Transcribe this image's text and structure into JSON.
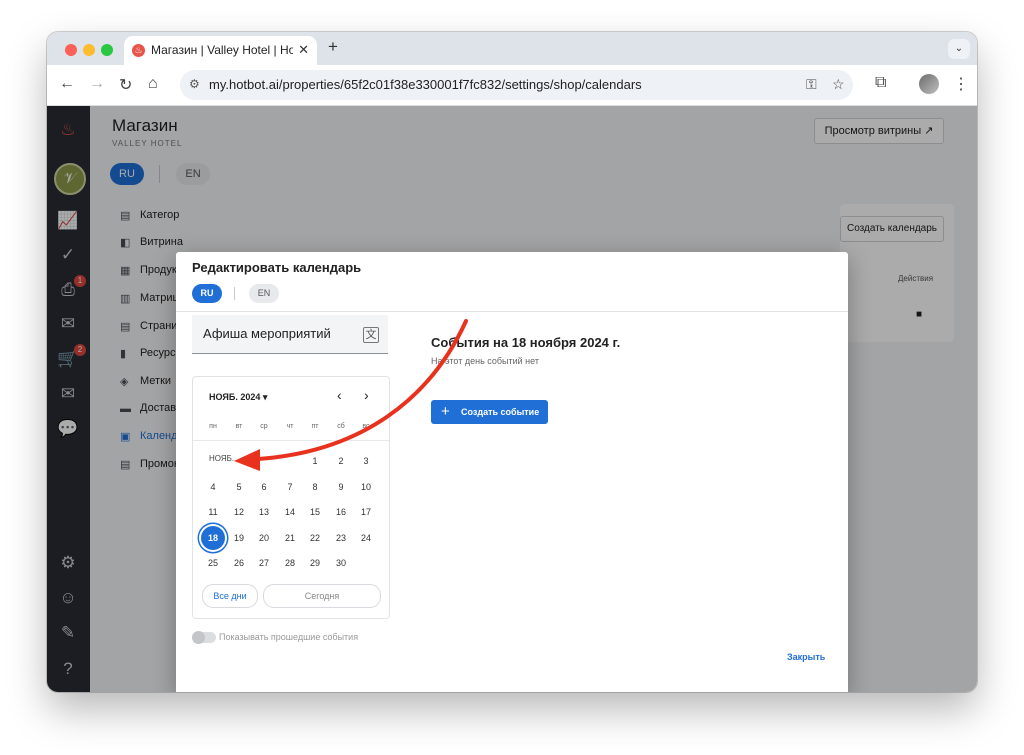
{
  "browser": {
    "tab_title": "Магазин | Valley Hotel | Hotbot",
    "tab_favicon": "flame-icon",
    "url": "my.hotbot.ai/properties/65f2c01f38e330001f7fc832/settings/shop/calendars"
  },
  "app": {
    "shop_title": "Магазин",
    "shop_subtitle": "VALLEY HOTEL",
    "storefront_button": "Просмотр витрины ↗",
    "lang_ru": "RU",
    "lang_en": "EN",
    "sidebar_badges": {
      "inbox": "1",
      "cart": "2"
    },
    "menu": [
      {
        "label": "Категор",
        "icon": "category-icon"
      },
      {
        "label": "Витрина",
        "icon": "storefront-icon"
      },
      {
        "label": "Продукт",
        "icon": "products-icon"
      },
      {
        "label": "Матрица",
        "icon": "matrix-icon"
      },
      {
        "label": "Страниц",
        "icon": "page-icon"
      },
      {
        "label": "Ресурсы",
        "icon": "resources-icon"
      },
      {
        "label": "Метки",
        "icon": "tag-icon"
      },
      {
        "label": "Доставк",
        "icon": "delivery-icon"
      },
      {
        "label": "Календ",
        "icon": "calendar-icon"
      },
      {
        "label": "Промок",
        "icon": "promo-icon"
      }
    ],
    "create_calendar_button": "Создать календарь",
    "actions_header": "Действия"
  },
  "modal": {
    "title": "Редактировать календарь",
    "lang_ru": "RU",
    "lang_en": "EN",
    "calendar_name": "Афиша мероприятий",
    "month_label": "НОЯБ. 2024",
    "weekdays": [
      "пн",
      "вт",
      "ср",
      "чт",
      "пт",
      "сб",
      "вс"
    ],
    "grid_month_label": "НОЯБ.",
    "days": [
      1,
      2,
      3,
      4,
      5,
      6,
      7,
      8,
      9,
      10,
      11,
      12,
      13,
      14,
      15,
      16,
      17,
      18,
      19,
      20,
      21,
      22,
      23,
      24,
      25,
      26,
      27,
      28,
      29,
      30
    ],
    "selected_day": 18,
    "first_weekday_index": 4,
    "all_days_button": "Все дни",
    "today_button": "Сегодня",
    "show_past_label": "Показывать прошедшие события",
    "events_title": "События на 18 ноября 2024 г.",
    "no_events_text": "На этот день событий нет",
    "create_event_button": "Создать событие",
    "close_button": "Закрыть"
  },
  "colors": {
    "accent": "#1f6fd6",
    "annotation_arrow": "#e8321e",
    "sidebar_bg": "#2a2c33"
  }
}
